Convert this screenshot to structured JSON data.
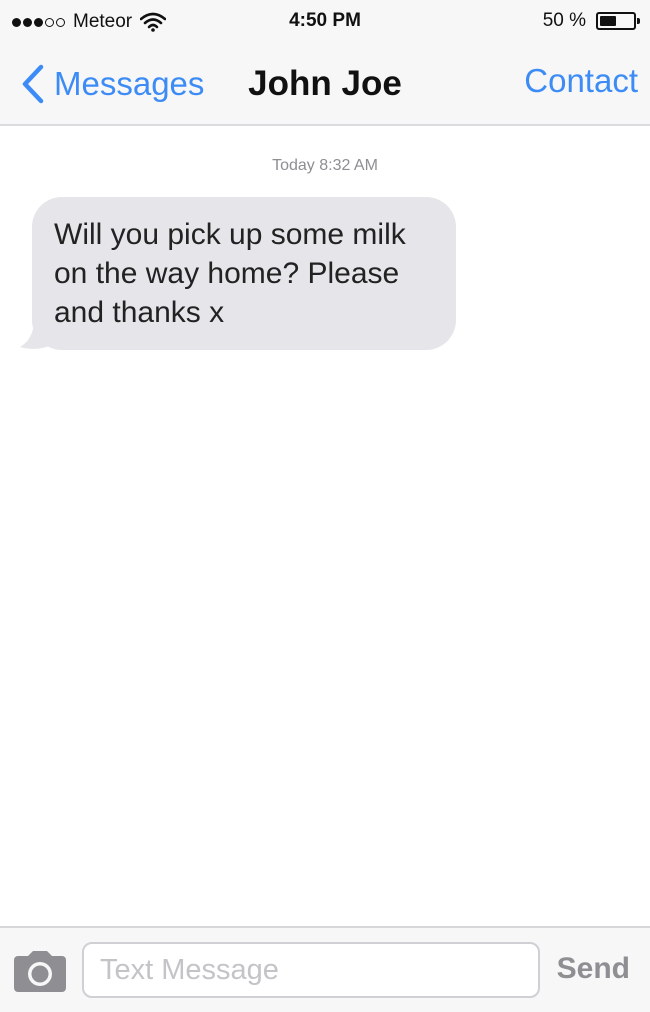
{
  "status_bar": {
    "signal_bars_filled": 3,
    "signal_bars_total": 5,
    "carrier": "Meteor",
    "time": "4:50 PM",
    "battery_percent": "50 %",
    "battery_level": 0.5
  },
  "nav": {
    "back_label": "Messages",
    "title": "John Joe",
    "contact_label": "Contact"
  },
  "conversation": {
    "timestamp": "Today 8:32 AM",
    "messages": [
      {
        "direction": "incoming",
        "text": "Will you pick up some milk on the way home? Please and thanks x"
      }
    ]
  },
  "composer": {
    "placeholder": "Text Message",
    "value": "",
    "send_label": "Send",
    "camera_icon": "camera-icon"
  },
  "colors": {
    "accent": "#3d8cf5",
    "incoming_bubble": "#e5e5ea",
    "bar_background": "#f7f7f8",
    "muted_text": "#8e8e93"
  }
}
